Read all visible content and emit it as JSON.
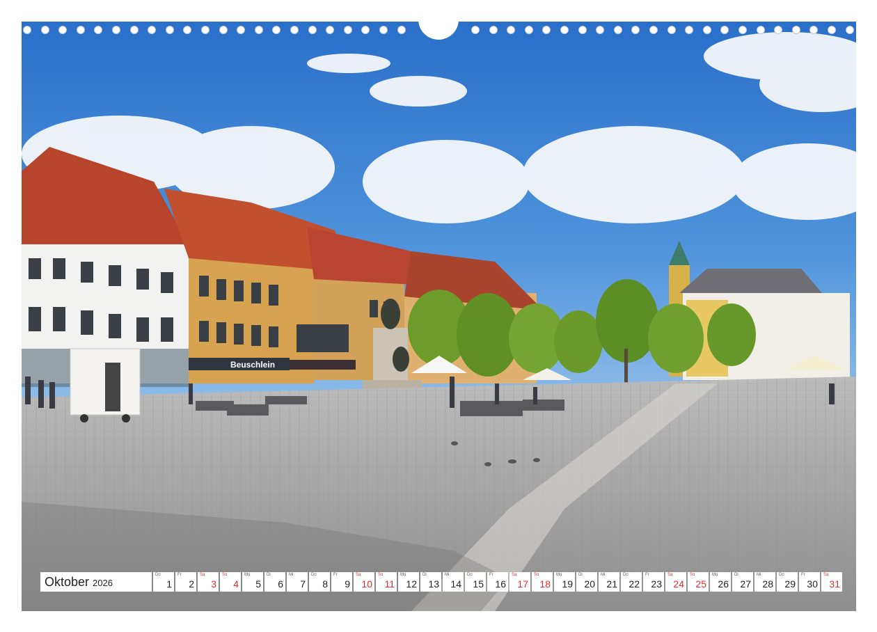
{
  "calendar": {
    "month": "Oktober",
    "year": "2026",
    "days": [
      {
        "wd": "Do",
        "n": "1",
        "we": false
      },
      {
        "wd": "Fr",
        "n": "2",
        "we": false
      },
      {
        "wd": "Sa",
        "n": "3",
        "we": true
      },
      {
        "wd": "So",
        "n": "4",
        "we": true
      },
      {
        "wd": "Mo",
        "n": "5",
        "we": false
      },
      {
        "wd": "Di",
        "n": "6",
        "we": false
      },
      {
        "wd": "Mi",
        "n": "7",
        "we": false
      },
      {
        "wd": "Do",
        "n": "8",
        "we": false
      },
      {
        "wd": "Fr",
        "n": "9",
        "we": false
      },
      {
        "wd": "Sa",
        "n": "10",
        "we": true
      },
      {
        "wd": "So",
        "n": "11",
        "we": true
      },
      {
        "wd": "Mo",
        "n": "12",
        "we": false
      },
      {
        "wd": "Di",
        "n": "13",
        "we": false
      },
      {
        "wd": "Mi",
        "n": "14",
        "we": false
      },
      {
        "wd": "Do",
        "n": "15",
        "we": false
      },
      {
        "wd": "Fr",
        "n": "16",
        "we": false
      },
      {
        "wd": "Sa",
        "n": "17",
        "we": true
      },
      {
        "wd": "So",
        "n": "18",
        "we": true
      },
      {
        "wd": "Mo",
        "n": "19",
        "we": false
      },
      {
        "wd": "Di",
        "n": "20",
        "we": false
      },
      {
        "wd": "Mi",
        "n": "21",
        "we": false
      },
      {
        "wd": "Do",
        "n": "22",
        "we": false
      },
      {
        "wd": "Fr",
        "n": "23",
        "we": false
      },
      {
        "wd": "Sa",
        "n": "24",
        "we": true
      },
      {
        "wd": "So",
        "n": "25",
        "we": true
      },
      {
        "wd": "Mo",
        "n": "26",
        "we": false
      },
      {
        "wd": "Di",
        "n": "27",
        "we": false
      },
      {
        "wd": "Mi",
        "n": "28",
        "we": false
      },
      {
        "wd": "Do",
        "n": "29",
        "we": false
      },
      {
        "wd": "Fr",
        "n": "30",
        "we": false
      },
      {
        "wd": "Sa",
        "n": "31",
        "we": true
      }
    ]
  },
  "photo": {
    "shop_sign": "Beuschlein"
  },
  "colors": {
    "weekend": "#e0302a",
    "sky": "#2f78cf",
    "roof": "#b6452c"
  }
}
